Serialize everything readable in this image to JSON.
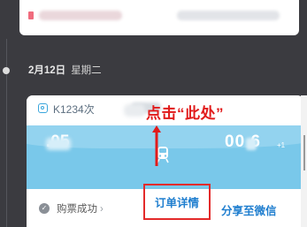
{
  "top_card": {},
  "date": {
    "day": "2月12日",
    "weekday": "星期二"
  },
  "ticket": {
    "train_no": "K1234次",
    "departure_time": ".05",
    "arrival_time": "00:_6",
    "arrival_time_display": "00 6",
    "arrival_day_offset": "+1",
    "status": "购票成功",
    "status_chevron": "›",
    "detail_button": "订单详情",
    "share_button": "分享至微信"
  },
  "annotation": {
    "text": "点击“此处”"
  },
  "colors": {
    "band": "#79c8ea",
    "link": "#1f7ecf",
    "annotation": "#e11b1b",
    "background": "#3b3b40"
  }
}
